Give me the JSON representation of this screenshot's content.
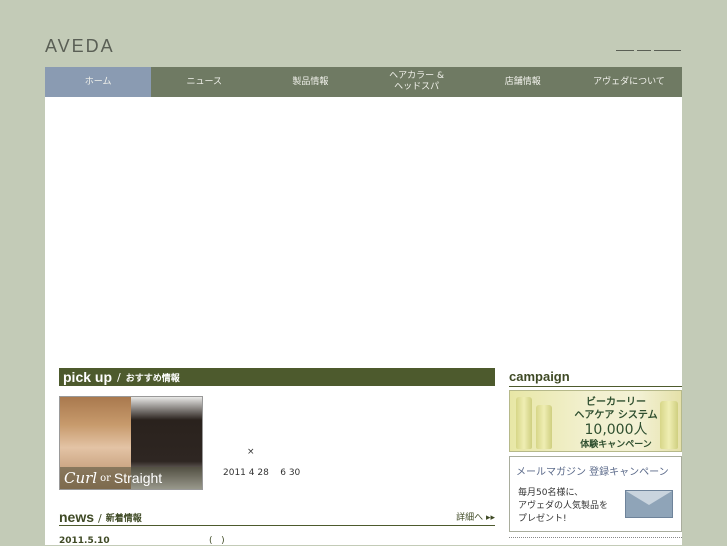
{
  "header": {
    "logo": "AVEDA"
  },
  "nav": [
    {
      "label": "ホーム",
      "active": true
    },
    {
      "label": "ニュース"
    },
    {
      "label": "製品情報"
    },
    {
      "label": "ヘアカラー &\nヘッドスパ"
    },
    {
      "label": "店舗情報"
    },
    {
      "label": "アヴェダについて"
    }
  ],
  "pickup": {
    "title_en": "pick up",
    "separator": "/",
    "title_jp": "おすすめ情報",
    "image_caption": {
      "curl": "Curl",
      "or": "or",
      "straight": "Straight"
    },
    "mark": "×",
    "date_text": "2011 4 28    6 30"
  },
  "news": {
    "title_en": "news",
    "separator": "/",
    "title_jp": "新着情報",
    "more": "詳細へ ▸▸",
    "items": [
      {
        "date": "2011.5.10",
        "paren": "(   )"
      }
    ]
  },
  "campaign": {
    "title": "campaign",
    "banner1": {
      "line1": "ビーカーリー",
      "line2": "ヘアケア システム",
      "line3": "10,000人",
      "line4": "体験キャンペーン"
    },
    "banner2": {
      "title": "メールマガジン 登録キャンペーン",
      "line1": "毎月50名様に、",
      "line2": "アヴェダの人気製品を",
      "line3": "プレゼント!"
    }
  },
  "colors": {
    "background": "#c3cbb7",
    "nav": "#6f7a63",
    "nav_active": "#8a9bb2",
    "section": "#4d5a2d"
  }
}
